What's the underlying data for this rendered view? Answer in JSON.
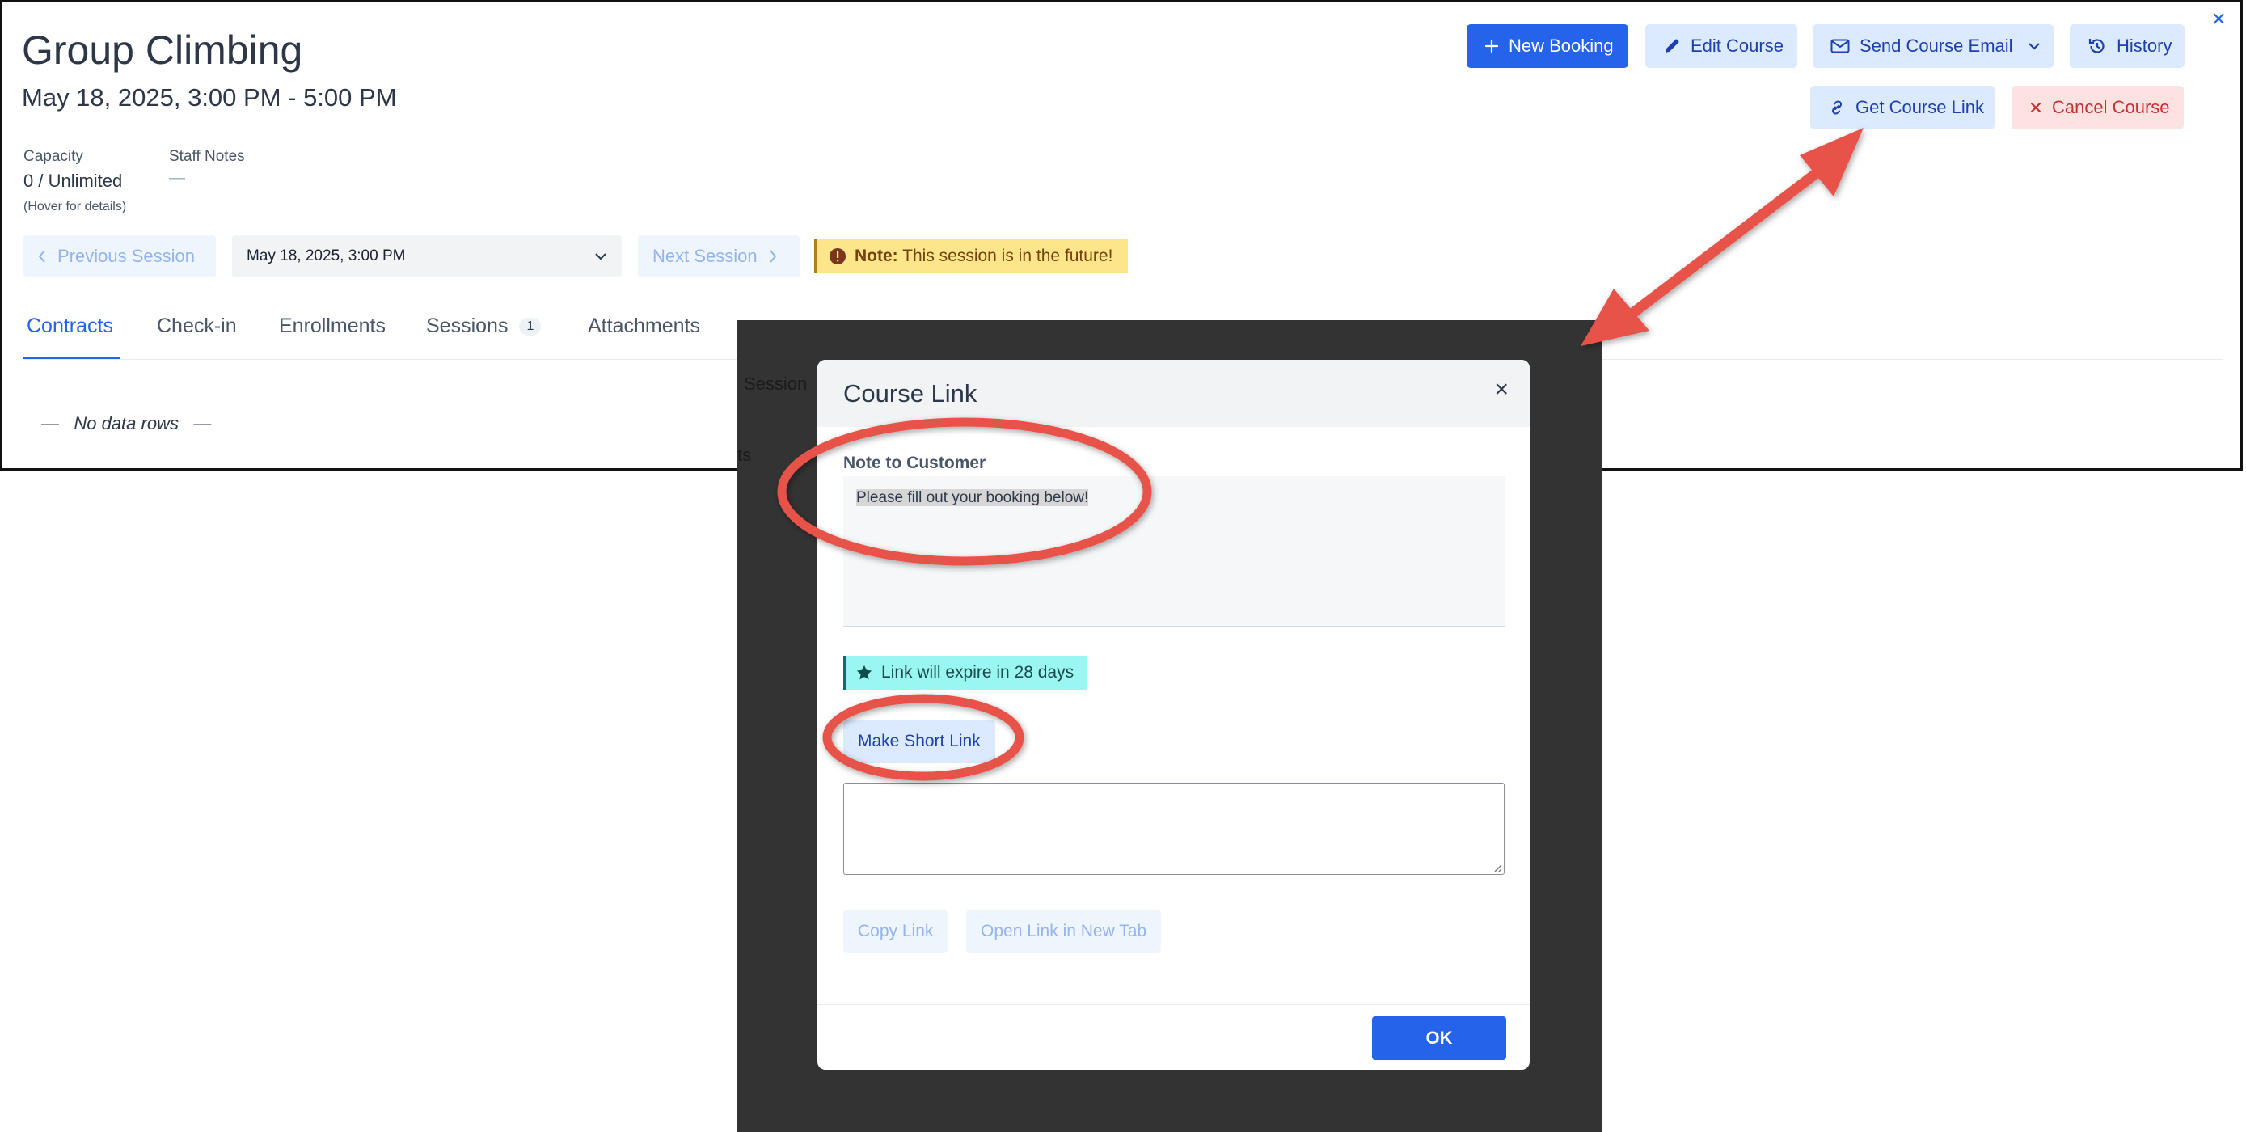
{
  "page": {
    "title": "Group Climbing",
    "subtitle": "May 18, 2025, 3:00 PM - 5:00 PM",
    "close_glyph": "×",
    "capacity_label": "Capacity",
    "capacity_value": "0 / Unlimited",
    "capacity_hint": "(Hover for details)",
    "staff_notes_label": "Staff Notes",
    "staff_notes_value": "—"
  },
  "toolbar": {
    "new_booking": "New Booking",
    "edit_course": "Edit Course",
    "send_course_email": "Send Course Email",
    "history": "History",
    "get_course_link": "Get Course Link",
    "cancel_course": "Cancel Course"
  },
  "session_nav": {
    "previous": "Previous Session",
    "selected": "May 18, 2025, 3:00 PM",
    "next": "Next Session",
    "note_label": "Note:",
    "note_text": "This session is in the future!"
  },
  "tabs": {
    "contracts": "Contracts",
    "checkin": "Check-in",
    "enrollments": "Enrollments",
    "sessions": "Sessions",
    "sessions_count": "1",
    "attachments": "Attachments"
  },
  "empty": {
    "dash_left": "—",
    "text": "No data rows",
    "dash_right": "—"
  },
  "background_fragments": {
    "session": "Session",
    "ts": "ts"
  },
  "modal": {
    "title": "Course Link",
    "close_glyph": "×",
    "note_label": "Note to Customer",
    "note_value": "Please fill out your booking below!",
    "expire_text": "Link will expire in 28 days",
    "make_short_link": "Make Short Link",
    "copy_link": "Copy Link",
    "open_new_tab": "Open Link in New Tab",
    "ok": "OK"
  },
  "colors": {
    "primary": "#2563eb",
    "annotation": "#e8534a",
    "note_bg": "#fde68a",
    "expire_bg": "#99f6f0"
  }
}
